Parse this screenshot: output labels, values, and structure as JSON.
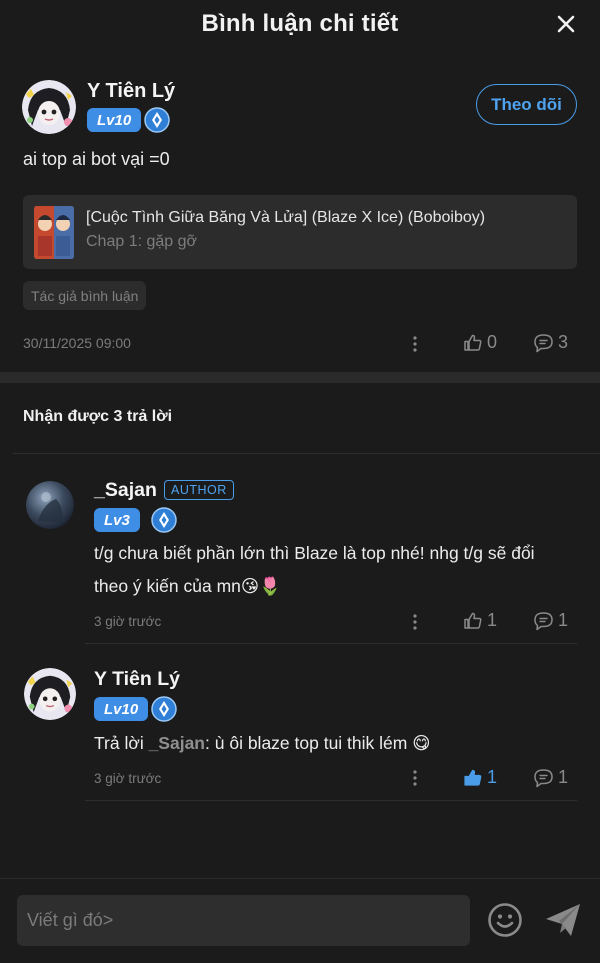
{
  "header": {
    "title": "Bình luận chi tiết"
  },
  "main_comment": {
    "user_name": "Y Tiên Lý",
    "level": "Lv10",
    "follow_label": "Theo dõi",
    "text": "ai top ai bot vại =0",
    "story": {
      "title": "[Cuộc Tình Giữa Băng Và Lửa] (Blaze X Ice) (Boboiboy)",
      "chapter": "Chap 1: gặp gỡ"
    },
    "tag": "Tác giả bình luận",
    "timestamp": "30/11/2025 09:00",
    "likes": "0",
    "replies": "3"
  },
  "replies_header": "Nhận được 3 trả lời",
  "replies": [
    {
      "user_name": "_Sajan",
      "author_badge": "AUTHOR",
      "level": "Lv3",
      "text_line1": "t/g chưa biết phần lớn thì Blaze là top nhé! nhg t/g sẽ đổi",
      "text_line2": "theo ý kiến của mn",
      "emojis": "😘🌷",
      "time": "3 giờ trước",
      "likes": "1",
      "replies": "1"
    },
    {
      "user_name": "Y Tiên Lý",
      "level": "Lv10",
      "reply_prefix": "Trả lời ",
      "mention": "_Sajan",
      "text": ": ù ôi blaze top tui thik lém",
      "emoji": "😋",
      "time": "3 giờ trước",
      "likes": "1",
      "replies": "1"
    }
  ],
  "composer": {
    "placeholder": "Viết gì đó>"
  },
  "colors": {
    "accent": "#4a9be8",
    "background": "#1b1b1b",
    "card": "#2c2c2c",
    "muted": "#7b7b7b"
  },
  "icons": [
    "close-icon",
    "rank-icon",
    "more-icon",
    "thumbs-up-icon",
    "comment-icon",
    "emoji-icon",
    "send-icon"
  ]
}
